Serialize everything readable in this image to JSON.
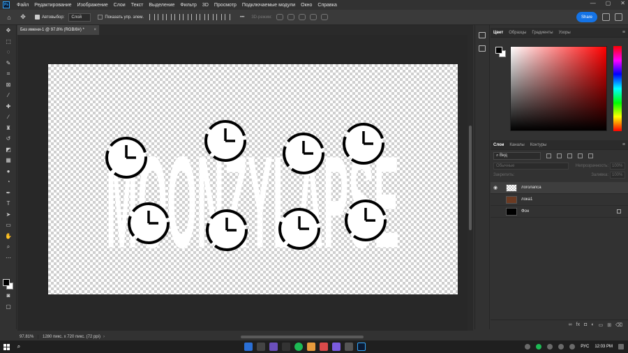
{
  "app": {
    "logo_text": "Ps"
  },
  "menu": [
    "Файл",
    "Редактирование",
    "Изображение",
    "Слои",
    "Текст",
    "Выделение",
    "Фильтр",
    "3D",
    "Просмотр",
    "Подключаемые модули",
    "Окно",
    "Справка"
  ],
  "window_controls": {
    "minimize": "—",
    "maximize": "▢",
    "close": "✕"
  },
  "options_bar": {
    "autoselect_label": "Автовыбор:",
    "autoselect_value": "Слой",
    "show_controls_label": "Показать упр. элем.",
    "more_label": "•••",
    "mode_3d_label": "3D-режим:",
    "share_label": "Share"
  },
  "document": {
    "tab_title": "Без имени-1 @ 97.8% (RGB/8#) *",
    "tab_close": "×",
    "zoom": "97.81%",
    "size_info": "1280 пикс. x 720 пикс. (72 ppi)",
    "arrow": "›"
  },
  "canvas_art": {
    "text": "MOONZYLAPSE",
    "text_color": "#ffffff"
  },
  "color_panel": {
    "tabs": [
      "Цвет",
      "Образцы",
      "Градиенты",
      "Узоры"
    ],
    "active_tab": "Цвет",
    "foreground": "#000000",
    "background": "#ffffff",
    "menu_icon": "≡"
  },
  "layers_panel": {
    "tabs": [
      "Слои",
      "Каналы",
      "Контуры"
    ],
    "active_tab": "Слои",
    "filter_label": "Вид",
    "blend_mode": "Обычные",
    "opacity_label": "Непрозрачность:",
    "opacity_value": "100%",
    "lock_label": "Закрепить:",
    "fill_label": "Заливка:",
    "fill_value": "100%",
    "layers": [
      {
        "name": "логолапса",
        "visible": true,
        "locked": false,
        "thumb": "checker"
      },
      {
        "name": "лока1",
        "visible": false,
        "locked": false,
        "thumb": "photo"
      },
      {
        "name": "Фон",
        "visible": false,
        "locked": true,
        "thumb": "black"
      }
    ],
    "bottom_icons": [
      "link-icon",
      "fx-icon",
      "mask-icon",
      "adjustment-icon",
      "group-icon",
      "new-layer-icon",
      "trash-icon"
    ],
    "fx_label": "fx"
  },
  "taskbar": {
    "search_icon": "⌕",
    "language": "РУС",
    "time": "12:03 PM"
  }
}
